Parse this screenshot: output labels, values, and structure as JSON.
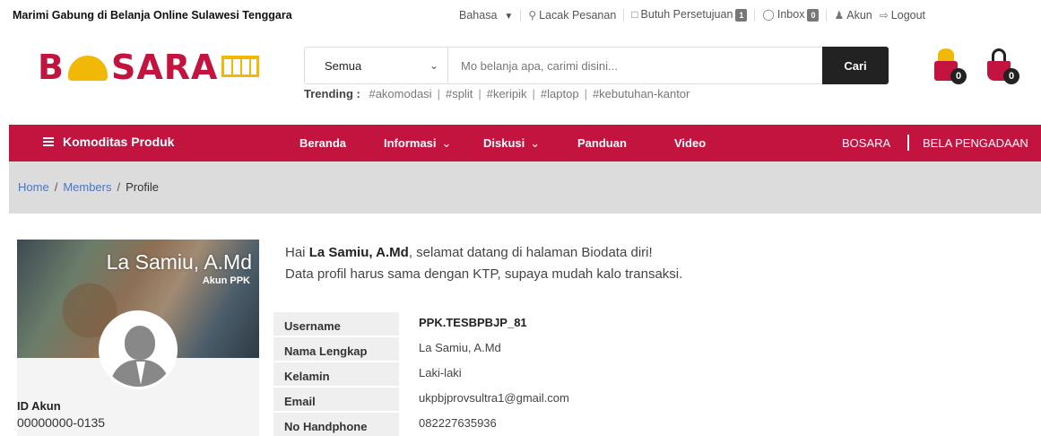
{
  "topbar": {
    "tagline": "Marimi Gabung di Belanja Online Sulawesi Tenggara",
    "language_label": "Bahasa",
    "track_order": "Lacak Pesanan",
    "approval": "Butuh Persetujuan",
    "approval_count": "1",
    "inbox": "Inbox",
    "inbox_count": "0",
    "account": "Akun",
    "logout": "Logout"
  },
  "logo": {
    "text_left": "B",
    "text_right": "SARA"
  },
  "search": {
    "category": "Semua",
    "placeholder": "Mo belanja apa, carimi disini...",
    "button": "Cari"
  },
  "trending": {
    "label": "Trending :",
    "tags": [
      "#akomodasi",
      "#split",
      "#keripik",
      "#laptop",
      "#kebutuhan-kantor"
    ]
  },
  "header_icons": {
    "gift_count": "0",
    "cart_count": "0"
  },
  "nav": {
    "commodity": "Komoditas Produk",
    "items": [
      "Beranda",
      "Informasi",
      "Diskusi",
      "Panduan",
      "Video"
    ],
    "right_items": [
      "BOSARA",
      "BELA PENGADAAN"
    ]
  },
  "breadcrumb": {
    "home": "Home",
    "members": "Members",
    "current": "Profile"
  },
  "profile": {
    "display_name": "La Samiu, A.Md",
    "role": "Akun PPK",
    "id_label": "ID Akun",
    "id_value": "00000000-0135"
  },
  "greeting": {
    "prefix": "Hai ",
    "name": "La Samiu, A.Md",
    "suffix": ", selamat datang di halaman Biodata diri!",
    "line2": "Data profil harus sama dengan KTP, supaya mudah kalo transaksi."
  },
  "fields": [
    {
      "label": "Username",
      "value": "PPK.TESBPBJP_81"
    },
    {
      "label": "Nama Lengkap",
      "value": "La Samiu, A.Md"
    },
    {
      "label": "Kelamin",
      "value": "Laki-laki"
    },
    {
      "label": "Email",
      "value": "ukpbjprovsultra1@gmail.com"
    },
    {
      "label": "No Handphone",
      "value": "082227635936"
    }
  ],
  "colors": {
    "brand": "#c2143f",
    "accent": "#f2b807",
    "link": "#4a76c2"
  }
}
